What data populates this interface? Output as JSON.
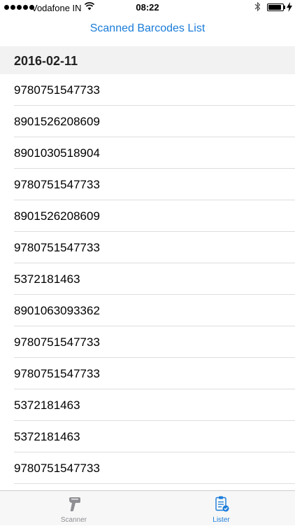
{
  "status_bar": {
    "carrier": "Vodafone IN",
    "time": "08:22",
    "battery_level": 0.92
  },
  "nav": {
    "title": "Scanned Barcodes List"
  },
  "section": {
    "date": "2016-02-11"
  },
  "barcodes": [
    "9780751547733",
    "8901526208609",
    "8901030518904",
    "9780751547733",
    "8901526208609",
    "9780751547733",
    "5372181463",
    "8901063093362",
    "9780751547733",
    "9780751547733",
    "5372181463",
    "5372181463",
    "9780751547733"
  ],
  "tab_bar": {
    "scanner_label": "Scanner",
    "lister_label": "Lister",
    "scanner_icon": "barcode-scanner-icon",
    "lister_icon": "clipboard-list-icon",
    "active_tab": "Lister",
    "active_color": "#1a7cd9",
    "inactive_color": "#8e8e93"
  }
}
